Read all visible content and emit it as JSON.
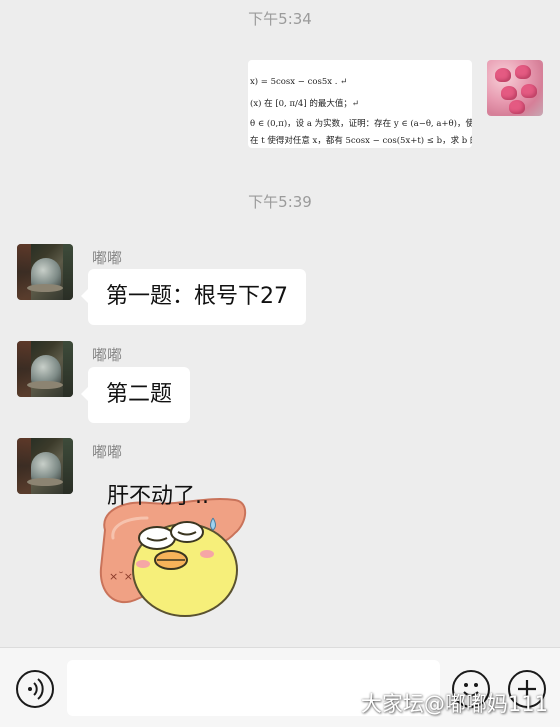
{
  "timestamps": [
    "下午5:34",
    "下午5:39"
  ],
  "image_message": {
    "lines": [
      "x) = 5cosx − cos5x . ↵",
      "(x) 在 [0, π/4] 的最大值；↵",
      "θ ∈ (0,π)，设 a 为实数，证明：存在 y ∈ (a−θ, a+θ)，使得",
      "在 t 使得对任意 x，都有 5cosx − cos(5x+t) ≤ b，求 b 的最小"
    ]
  },
  "messages": [
    {
      "sender": "嘟嘟",
      "text": "第一题：根号下27"
    },
    {
      "sender": "嘟嘟",
      "text": "第二题"
    },
    {
      "sender": "嘟嘟",
      "sticker_text": "肝不动了.."
    }
  ],
  "input": {
    "value": "",
    "placeholder": ""
  },
  "icons": {
    "voice": "voice-icon",
    "emoji": "emoji-icon",
    "more": "plus-icon"
  },
  "watermark": "大家坛@嘟嘟妈111"
}
